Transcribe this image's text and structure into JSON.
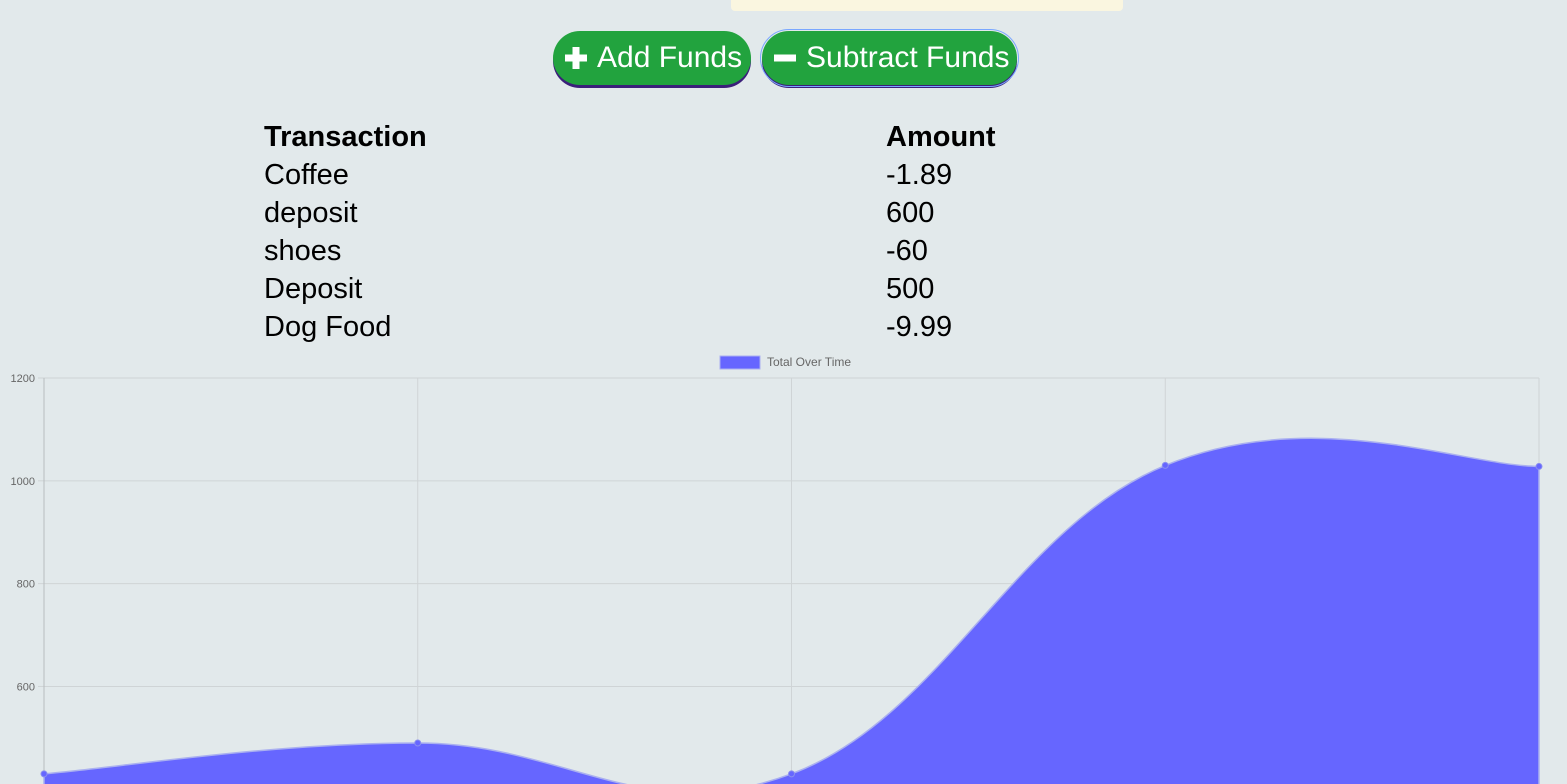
{
  "buttons": {
    "add_label": "Add Funds",
    "add_icon": "plus-icon",
    "subtract_label": "Subtract Funds",
    "subtract_icon": "minus-icon"
  },
  "table": {
    "headers": [
      "Transaction",
      "Amount"
    ],
    "rows": [
      {
        "name": "Coffee",
        "amount": "-1.89"
      },
      {
        "name": "deposit",
        "amount": "600"
      },
      {
        "name": "shoes",
        "amount": "-60"
      },
      {
        "name": "Deposit",
        "amount": "500"
      },
      {
        "name": "Dog Food",
        "amount": "-9.99"
      }
    ]
  },
  "colors": {
    "button_green": "#22a33e",
    "chart_fill": "#6666ff",
    "background": "#e2e9eb"
  },
  "chart_data": {
    "type": "area",
    "title": "",
    "xlabel": "",
    "ylabel": "",
    "legend": "top-center",
    "grid": true,
    "ylim": [
      400,
      1200
    ],
    "yticks": [
      600,
      800,
      1000,
      1200
    ],
    "series": [
      {
        "name": "Total Over Time",
        "values": [
          430,
          490,
          430,
          1030,
          1028
        ]
      }
    ]
  }
}
